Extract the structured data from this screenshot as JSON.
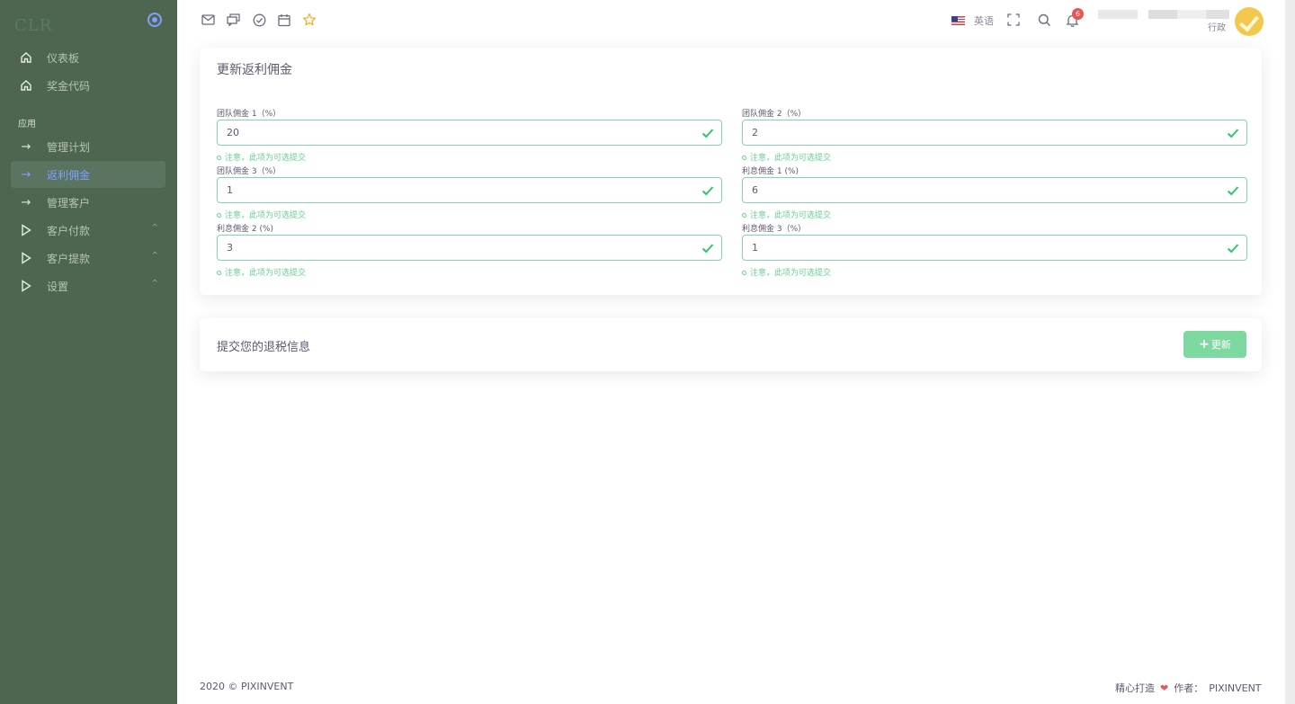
{
  "sidebar": {
    "brand": "CLR",
    "items": [
      {
        "label": "仪表板",
        "icon": "home-icon"
      },
      {
        "label": "奖金代码",
        "icon": "home-icon"
      }
    ],
    "section_label": "应用",
    "app_items": [
      {
        "label": "管理计划",
        "icon": "arrow-right-icon"
      },
      {
        "label": "返利佣金",
        "icon": "arrow-right-icon",
        "active": true
      },
      {
        "label": "管理客户",
        "icon": "arrow-right-icon"
      },
      {
        "label": "客户付款",
        "icon": "play-icon",
        "caret": "^"
      },
      {
        "label": "客户提款",
        "icon": "play-icon",
        "caret": "^"
      },
      {
        "label": "设置",
        "icon": "play-icon",
        "caret": "^"
      }
    ]
  },
  "topbar": {
    "language": "英语",
    "notification_count": "6",
    "user_role": "行政"
  },
  "form_card": {
    "title": "更新返利佣金",
    "fields": [
      {
        "label": "团队佣金 1（%）",
        "value": "20",
        "hint": "注意，此项为可选提交"
      },
      {
        "label": "团队佣金 2（%）",
        "value": "2",
        "hint": "注意，此项为可选提交"
      },
      {
        "label": "团队佣金 3（%）",
        "value": "1",
        "hint": "注意，此项为可选提交"
      },
      {
        "label": "利息佣金 1 (%)",
        "value": "6",
        "hint": "注意，此项为可选提交"
      },
      {
        "label": "利息佣金 2 (%)",
        "value": "3",
        "hint": "注意，此项为可选提交"
      },
      {
        "label": "利息佣金 3（%）",
        "value": "1",
        "hint": "注意，此项为可选提交"
      }
    ]
  },
  "submit_card": {
    "title": "提交您的退税信息",
    "button_label": "更新",
    "button_icon": "+"
  },
  "footer": {
    "copyright": "2020 © PIXINVENT",
    "crafted": "精心打造",
    "author_label": "作者：",
    "author": "PIXINVENT"
  },
  "colors": {
    "sidebar_bg": "#4e6650",
    "accent": "#7ea0ff",
    "success": "#64d18e",
    "button": "#7ed9a0"
  }
}
